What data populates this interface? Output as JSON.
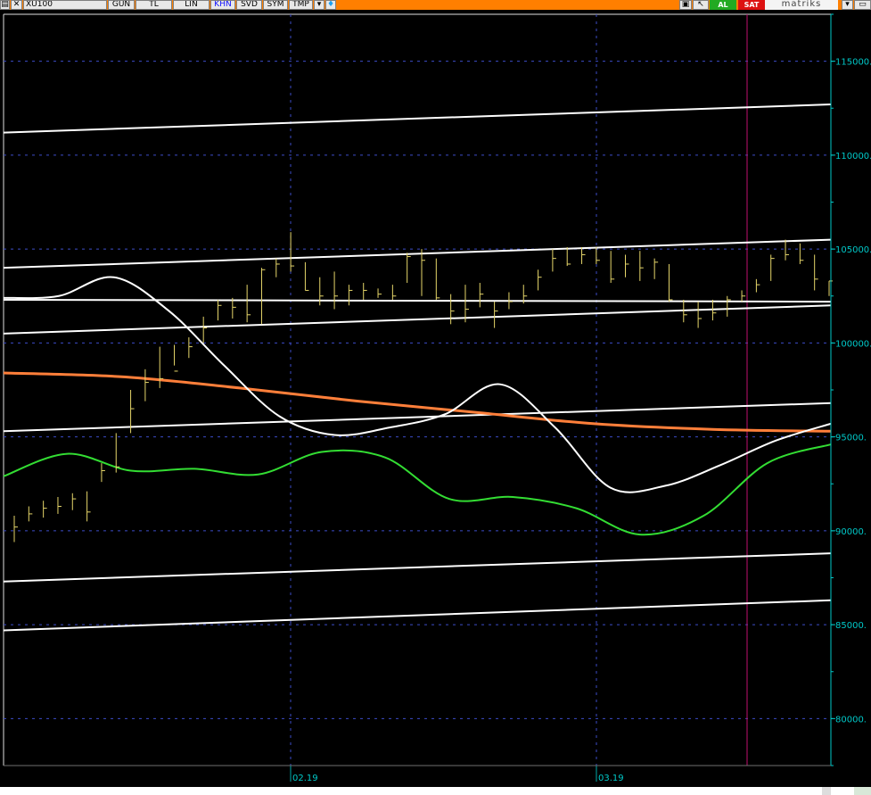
{
  "toolbar": {
    "symbol": "XU100",
    "buttons": [
      "GUN",
      "TL",
      "LIN",
      "KHN",
      "SVD",
      "SYM",
      "TMP"
    ],
    "buy_label": "AL",
    "sell_label": "SAT",
    "brand": "matriks",
    "colors": {
      "bar": "#ff7f00",
      "buy": "#22aa22",
      "sell": "#dd1111"
    }
  },
  "chart_data": {
    "type": "line",
    "ylim": [
      77500,
      117500
    ],
    "y_ticks": [
      115000,
      110000,
      105000,
      100000,
      95000,
      90000,
      85000,
      80000
    ],
    "y_tick_labels": [
      "115000.",
      "110000.",
      "105000.",
      "100000.",
      "95000.",
      "90000.",
      "85000.",
      "80000."
    ],
    "x_labels": [
      "02.19",
      "03.19"
    ],
    "grid": true,
    "colors": {
      "price": "#e6d66a",
      "ma": "#ff7f3a",
      "osc": "#ffffff",
      "lower": "#33dd33",
      "channel": "#ffffff",
      "grid": "#3c4cc8",
      "axis": "#00c8c8",
      "cursor": "#c01070"
    },
    "price_bars": [
      [
        89400,
        90800,
        90200
      ],
      [
        90500,
        91300,
        90900
      ],
      [
        90700,
        91600,
        91200
      ],
      [
        90900,
        91800,
        91300
      ],
      [
        91100,
        92000,
        91700
      ],
      [
        90500,
        92100,
        91000
      ],
      [
        92600,
        93600,
        93200
      ],
      [
        93100,
        95200,
        93400
      ],
      [
        95200,
        97500,
        96500
      ],
      [
        96900,
        98600,
        97900
      ],
      [
        97600,
        99800,
        98100
      ],
      [
        98800,
        99900,
        98500
      ],
      [
        99200,
        100300,
        99800
      ],
      [
        100000,
        101400,
        100800
      ],
      [
        101200,
        102300,
        102000
      ],
      [
        101300,
        102400,
        101900
      ],
      [
        101100,
        103100,
        101500
      ],
      [
        101000,
        104000,
        103900
      ],
      [
        103500,
        104500,
        104200
      ],
      [
        103800,
        105900,
        104100
      ],
      [
        102800,
        104300,
        102800
      ],
      [
        102000,
        103500,
        102500
      ],
      [
        101800,
        103800,
        102500
      ],
      [
        102000,
        103100,
        102800
      ],
      [
        102300,
        103200,
        102800
      ],
      [
        102400,
        102900,
        102600
      ],
      [
        102300,
        103100,
        102500
      ],
      [
        103200,
        104800,
        104600
      ],
      [
        102500,
        105000,
        104400
      ],
      [
        102300,
        104500,
        102400
      ],
      [
        101000,
        102600,
        101700
      ],
      [
        101100,
        103100,
        101800
      ],
      [
        101900,
        103200,
        102600
      ],
      [
        100800,
        102200,
        101700
      ],
      [
        101800,
        102700,
        102200
      ],
      [
        102100,
        103100,
        102500
      ],
      [
        102800,
        103900,
        103500
      ],
      [
        103800,
        105000,
        104500
      ],
      [
        104100,
        105100,
        104200
      ],
      [
        104200,
        105100,
        104700
      ],
      [
        104200,
        105100,
        104400
      ],
      [
        103200,
        104900,
        103400
      ],
      [
        103500,
        104700,
        104200
      ],
      [
        103300,
        104900,
        104000
      ],
      [
        103400,
        104500,
        104300
      ],
      [
        102200,
        104200,
        102300
      ],
      [
        101100,
        102300,
        101500
      ],
      [
        100800,
        102200,
        101300
      ],
      [
        101200,
        102300,
        101600
      ],
      [
        101400,
        102500,
        102300
      ],
      [
        102200,
        102800,
        102500
      ],
      [
        102700,
        103400,
        103100
      ],
      [
        103300,
        104700,
        104500
      ],
      [
        104400,
        105500,
        104700
      ],
      [
        104200,
        105300,
        104400
      ],
      [
        102800,
        104700,
        103400
      ],
      [
        102500,
        103300,
        103300
      ]
    ],
    "series": [
      {
        "values": [
          98400,
          98200,
          97600,
          96900,
          96300,
          95700,
          95400,
          95300
        ]
      },
      {
        "values": [
          102400,
          102500,
          103500,
          101700,
          98800,
          96100,
          95100,
          95500,
          96200,
          97800,
          95500,
          92300,
          92400,
          93500,
          94800,
          95700
        ]
      },
      {
        "values": [
          92900,
          94100,
          93200,
          93300,
          93000,
          94200,
          93900,
          91700,
          91800,
          91200,
          89800,
          90800,
          93600,
          94600
        ]
      }
    ],
    "channel_lines": [
      [
        111200,
        112700
      ],
      [
        104000,
        105500
      ],
      [
        102300,
        102200
      ],
      [
        100500,
        102000
      ],
      [
        95300,
        96800
      ],
      [
        87300,
        88800
      ],
      [
        84700,
        86300
      ]
    ]
  }
}
